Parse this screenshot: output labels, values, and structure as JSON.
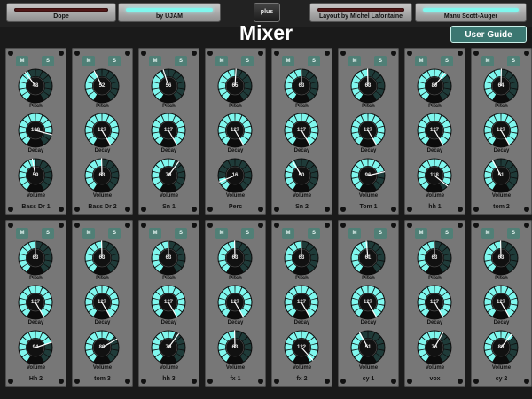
{
  "header": {
    "tab1": "Dope",
    "tab2": "by UJAM",
    "plus": "plus",
    "tab3": "Layout by Michel Lafontaine",
    "tab4": "Manu Scott-Auger",
    "title": "Mixer",
    "user_guide": "User Guide"
  },
  "strip_labels": {
    "mute": "M",
    "solo": "S",
    "pitch": "Pitch",
    "decay": "Decay",
    "volume": "Volume"
  },
  "colors": {
    "accent": "#7ff7ee",
    "panel": "#777777",
    "button": "#507f76"
  },
  "channels": [
    {
      "name": "Bass Dr 1",
      "pitch": "48",
      "decay": "108",
      "volume": "59"
    },
    {
      "name": "Bass Dr 2",
      "pitch": "52",
      "decay": "127",
      "volume": "63"
    },
    {
      "name": "Sn 1",
      "pitch": "56",
      "decay": "127",
      "volume": "79"
    },
    {
      "name": "Perc",
      "pitch": "65",
      "decay": "127",
      "volume": "16"
    },
    {
      "name": "Sn 2",
      "pitch": "63",
      "decay": "127",
      "volume": "50"
    },
    {
      "name": "Tom 1",
      "pitch": "63",
      "decay": "127",
      "volume": "96"
    },
    {
      "name": "hh 1",
      "pitch": "80",
      "decay": "127",
      "volume": "118"
    },
    {
      "name": "tom 2",
      "pitch": "64",
      "decay": "127",
      "volume": "51"
    },
    {
      "name": "Hh 2",
      "pitch": "63",
      "decay": "127",
      "volume": "94"
    },
    {
      "name": "tom 3",
      "pitch": "63",
      "decay": "127",
      "volume": "89"
    },
    {
      "name": "hh 3",
      "pitch": "63",
      "decay": "127",
      "volume": "79"
    },
    {
      "name": "fx 1",
      "pitch": "63",
      "decay": "127",
      "volume": "63"
    },
    {
      "name": "fx 2",
      "pitch": "63",
      "decay": "127",
      "volume": "122"
    },
    {
      "name": "cy 1",
      "pitch": "61",
      "decay": "127",
      "volume": "51"
    },
    {
      "name": "vox",
      "pitch": "63",
      "decay": "127",
      "volume": "76"
    },
    {
      "name": "cy 2",
      "pitch": "63",
      "decay": "127",
      "volume": "80"
    }
  ]
}
